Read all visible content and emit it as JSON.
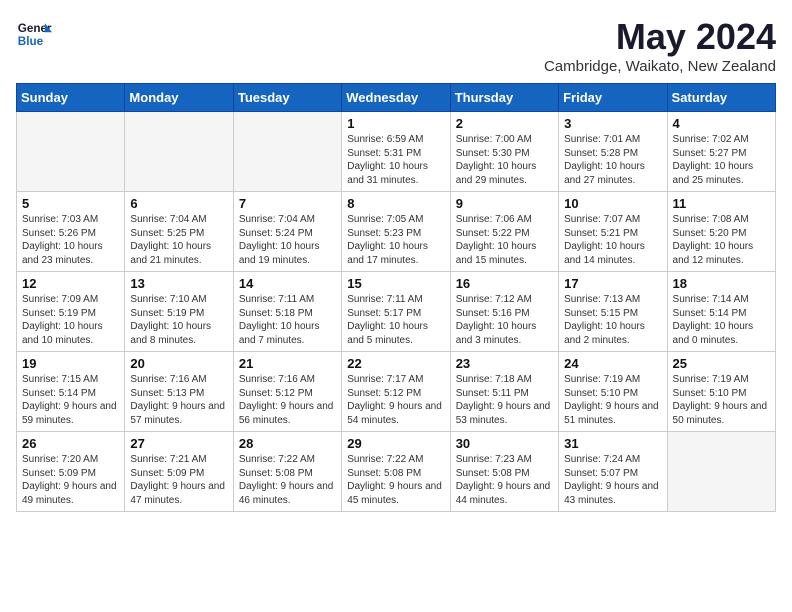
{
  "header": {
    "logo_line1": "General",
    "logo_line2": "Blue",
    "month": "May 2024",
    "location": "Cambridge, Waikato, New Zealand"
  },
  "weekdays": [
    "Sunday",
    "Monday",
    "Tuesday",
    "Wednesday",
    "Thursday",
    "Friday",
    "Saturday"
  ],
  "weeks": [
    [
      {
        "day": "",
        "sunrise": "",
        "sunset": "",
        "daylight": ""
      },
      {
        "day": "",
        "sunrise": "",
        "sunset": "",
        "daylight": ""
      },
      {
        "day": "",
        "sunrise": "",
        "sunset": "",
        "daylight": ""
      },
      {
        "day": "1",
        "sunrise": "Sunrise: 6:59 AM",
        "sunset": "Sunset: 5:31 PM",
        "daylight": "Daylight: 10 hours and 31 minutes."
      },
      {
        "day": "2",
        "sunrise": "Sunrise: 7:00 AM",
        "sunset": "Sunset: 5:30 PM",
        "daylight": "Daylight: 10 hours and 29 minutes."
      },
      {
        "day": "3",
        "sunrise": "Sunrise: 7:01 AM",
        "sunset": "Sunset: 5:28 PM",
        "daylight": "Daylight: 10 hours and 27 minutes."
      },
      {
        "day": "4",
        "sunrise": "Sunrise: 7:02 AM",
        "sunset": "Sunset: 5:27 PM",
        "daylight": "Daylight: 10 hours and 25 minutes."
      }
    ],
    [
      {
        "day": "5",
        "sunrise": "Sunrise: 7:03 AM",
        "sunset": "Sunset: 5:26 PM",
        "daylight": "Daylight: 10 hours and 23 minutes."
      },
      {
        "day": "6",
        "sunrise": "Sunrise: 7:04 AM",
        "sunset": "Sunset: 5:25 PM",
        "daylight": "Daylight: 10 hours and 21 minutes."
      },
      {
        "day": "7",
        "sunrise": "Sunrise: 7:04 AM",
        "sunset": "Sunset: 5:24 PM",
        "daylight": "Daylight: 10 hours and 19 minutes."
      },
      {
        "day": "8",
        "sunrise": "Sunrise: 7:05 AM",
        "sunset": "Sunset: 5:23 PM",
        "daylight": "Daylight: 10 hours and 17 minutes."
      },
      {
        "day": "9",
        "sunrise": "Sunrise: 7:06 AM",
        "sunset": "Sunset: 5:22 PM",
        "daylight": "Daylight: 10 hours and 15 minutes."
      },
      {
        "day": "10",
        "sunrise": "Sunrise: 7:07 AM",
        "sunset": "Sunset: 5:21 PM",
        "daylight": "Daylight: 10 hours and 14 minutes."
      },
      {
        "day": "11",
        "sunrise": "Sunrise: 7:08 AM",
        "sunset": "Sunset: 5:20 PM",
        "daylight": "Daylight: 10 hours and 12 minutes."
      }
    ],
    [
      {
        "day": "12",
        "sunrise": "Sunrise: 7:09 AM",
        "sunset": "Sunset: 5:19 PM",
        "daylight": "Daylight: 10 hours and 10 minutes."
      },
      {
        "day": "13",
        "sunrise": "Sunrise: 7:10 AM",
        "sunset": "Sunset: 5:19 PM",
        "daylight": "Daylight: 10 hours and 8 minutes."
      },
      {
        "day": "14",
        "sunrise": "Sunrise: 7:11 AM",
        "sunset": "Sunset: 5:18 PM",
        "daylight": "Daylight: 10 hours and 7 minutes."
      },
      {
        "day": "15",
        "sunrise": "Sunrise: 7:11 AM",
        "sunset": "Sunset: 5:17 PM",
        "daylight": "Daylight: 10 hours and 5 minutes."
      },
      {
        "day": "16",
        "sunrise": "Sunrise: 7:12 AM",
        "sunset": "Sunset: 5:16 PM",
        "daylight": "Daylight: 10 hours and 3 minutes."
      },
      {
        "day": "17",
        "sunrise": "Sunrise: 7:13 AM",
        "sunset": "Sunset: 5:15 PM",
        "daylight": "Daylight: 10 hours and 2 minutes."
      },
      {
        "day": "18",
        "sunrise": "Sunrise: 7:14 AM",
        "sunset": "Sunset: 5:14 PM",
        "daylight": "Daylight: 10 hours and 0 minutes."
      }
    ],
    [
      {
        "day": "19",
        "sunrise": "Sunrise: 7:15 AM",
        "sunset": "Sunset: 5:14 PM",
        "daylight": "Daylight: 9 hours and 59 minutes."
      },
      {
        "day": "20",
        "sunrise": "Sunrise: 7:16 AM",
        "sunset": "Sunset: 5:13 PM",
        "daylight": "Daylight: 9 hours and 57 minutes."
      },
      {
        "day": "21",
        "sunrise": "Sunrise: 7:16 AM",
        "sunset": "Sunset: 5:12 PM",
        "daylight": "Daylight: 9 hours and 56 minutes."
      },
      {
        "day": "22",
        "sunrise": "Sunrise: 7:17 AM",
        "sunset": "Sunset: 5:12 PM",
        "daylight": "Daylight: 9 hours and 54 minutes."
      },
      {
        "day": "23",
        "sunrise": "Sunrise: 7:18 AM",
        "sunset": "Sunset: 5:11 PM",
        "daylight": "Daylight: 9 hours and 53 minutes."
      },
      {
        "day": "24",
        "sunrise": "Sunrise: 7:19 AM",
        "sunset": "Sunset: 5:10 PM",
        "daylight": "Daylight: 9 hours and 51 minutes."
      },
      {
        "day": "25",
        "sunrise": "Sunrise: 7:19 AM",
        "sunset": "Sunset: 5:10 PM",
        "daylight": "Daylight: 9 hours and 50 minutes."
      }
    ],
    [
      {
        "day": "26",
        "sunrise": "Sunrise: 7:20 AM",
        "sunset": "Sunset: 5:09 PM",
        "daylight": "Daylight: 9 hours and 49 minutes."
      },
      {
        "day": "27",
        "sunrise": "Sunrise: 7:21 AM",
        "sunset": "Sunset: 5:09 PM",
        "daylight": "Daylight: 9 hours and 47 minutes."
      },
      {
        "day": "28",
        "sunrise": "Sunrise: 7:22 AM",
        "sunset": "Sunset: 5:08 PM",
        "daylight": "Daylight: 9 hours and 46 minutes."
      },
      {
        "day": "29",
        "sunrise": "Sunrise: 7:22 AM",
        "sunset": "Sunset: 5:08 PM",
        "daylight": "Daylight: 9 hours and 45 minutes."
      },
      {
        "day": "30",
        "sunrise": "Sunrise: 7:23 AM",
        "sunset": "Sunset: 5:08 PM",
        "daylight": "Daylight: 9 hours and 44 minutes."
      },
      {
        "day": "31",
        "sunrise": "Sunrise: 7:24 AM",
        "sunset": "Sunset: 5:07 PM",
        "daylight": "Daylight: 9 hours and 43 minutes."
      },
      {
        "day": "",
        "sunrise": "",
        "sunset": "",
        "daylight": ""
      }
    ]
  ]
}
